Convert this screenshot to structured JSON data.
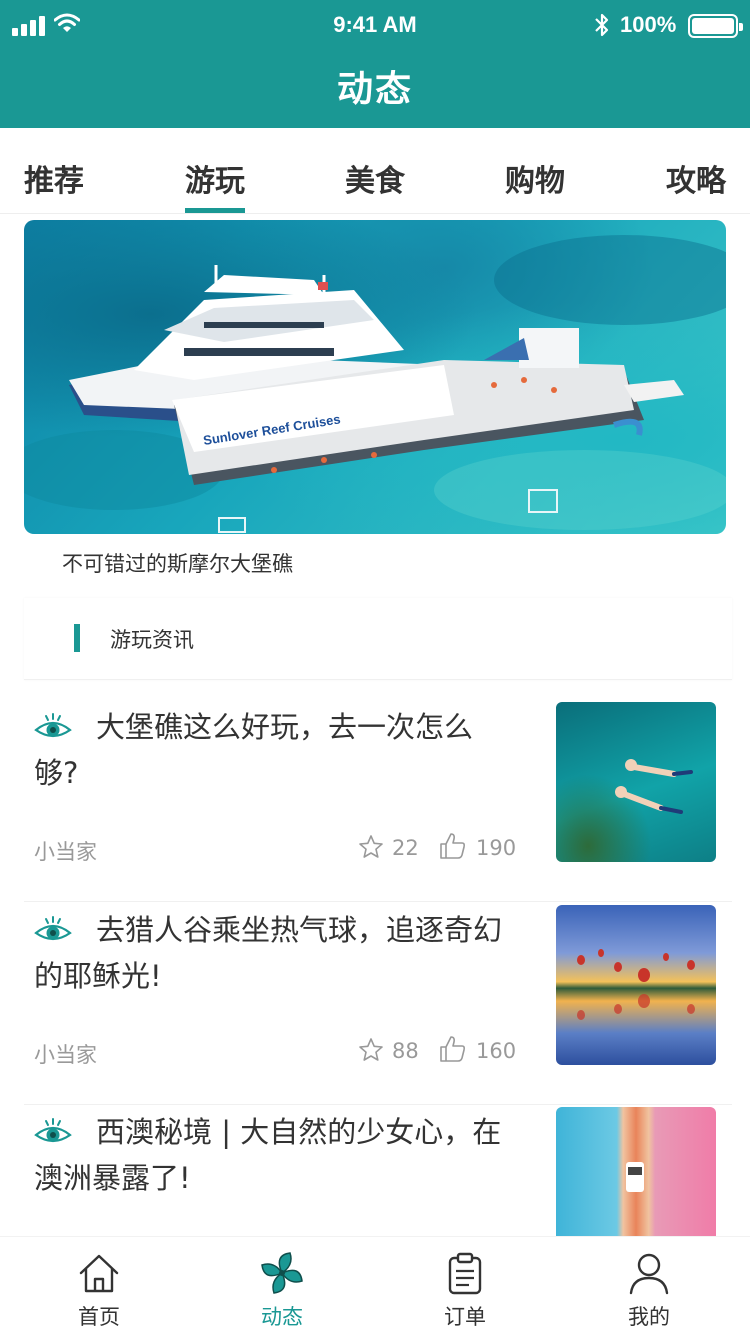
{
  "status_bar": {
    "time": "9:41 AM",
    "battery": "100%"
  },
  "header": {
    "title": "动态"
  },
  "tabs": [
    {
      "label": "推荐",
      "active": false
    },
    {
      "label": "游玩",
      "active": true
    },
    {
      "label": "美食",
      "active": false
    },
    {
      "label": "购物",
      "active": false
    },
    {
      "label": "攻略",
      "active": false
    }
  ],
  "banner": {
    "caption": "不可错过的斯摩尔大堡礁",
    "boat_text": "Sunlover Reef Cruises"
  },
  "section": {
    "title": "游玩资讯"
  },
  "articles": [
    {
      "title": "大堡礁这么好玩，去一次怎么够?",
      "author": "小当家",
      "favorites": "22",
      "likes": "190"
    },
    {
      "title": "去猎人谷乘坐热气球，追逐奇幻的耶稣光!",
      "author": "小当家",
      "favorites": "88",
      "likes": "160"
    },
    {
      "title": "西澳秘境 | 大自然的少女心，在澳洲暴露了!",
      "author": "",
      "favorites": "",
      "likes": ""
    }
  ],
  "bottom_nav": [
    {
      "label": "首页",
      "icon": "home-icon",
      "active": false
    },
    {
      "label": "动态",
      "icon": "pinwheel-icon",
      "active": true
    },
    {
      "label": "订单",
      "icon": "clipboard-icon",
      "active": false
    },
    {
      "label": "我的",
      "icon": "user-icon",
      "active": false
    }
  ],
  "colors": {
    "accent": "#1a9894",
    "text": "#333333",
    "muted": "#999999"
  }
}
